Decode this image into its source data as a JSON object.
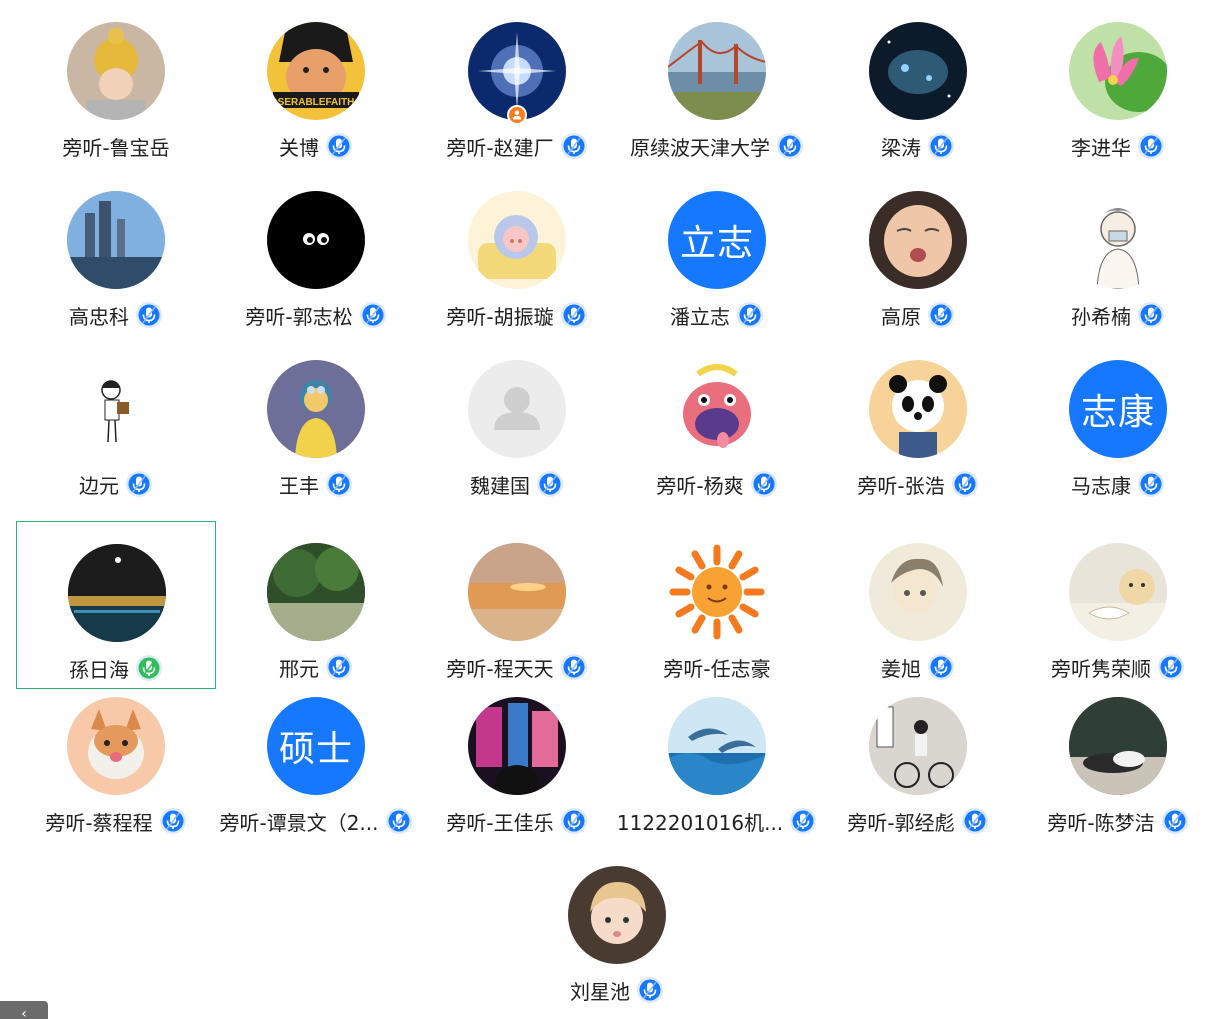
{
  "participants": [
    {
      "name": "旁听-鲁宝岳",
      "mic": "none",
      "avatar": "photo-child-yellow-hat"
    },
    {
      "name": "关博",
      "mic": "blue",
      "avatar": "photo-cartoon-face"
    },
    {
      "name": "旁听-赵建厂",
      "mic": "blue",
      "avatar": "photo-starburst",
      "host": true
    },
    {
      "name": "原续波天津大学",
      "mic": "blue",
      "avatar": "photo-golden-gate"
    },
    {
      "name": "梁涛",
      "mic": "blue",
      "avatar": "photo-space-ship"
    },
    {
      "name": "李进华",
      "mic": "blue",
      "avatar": "photo-lotus"
    },
    {
      "name": "高忠科",
      "mic": "blue",
      "avatar": "photo-skyline"
    },
    {
      "name": "旁听-郭志松",
      "mic": "blue",
      "avatar": "photo-black-eyes"
    },
    {
      "name": "旁听-胡振璇",
      "mic": "blue",
      "avatar": "photo-cartoon-pig-sleep"
    },
    {
      "name": "潘立志",
      "mic": "blue",
      "avatar_text": "立志"
    },
    {
      "name": "高原",
      "mic": "blue",
      "avatar": "photo-baby"
    },
    {
      "name": "孙希楠",
      "mic": "blue",
      "avatar": "photo-sketch-person"
    },
    {
      "name": "边元",
      "mic": "blue",
      "avatar": "photo-sketch-girl"
    },
    {
      "name": "王丰",
      "mic": "blue",
      "avatar": "photo-cartoon-yellow"
    },
    {
      "name": "魏建国",
      "mic": "blue",
      "avatar": "placeholder-person"
    },
    {
      "name": "旁听-杨爽",
      "mic": "blue",
      "avatar": "photo-cartoon-pig-banana"
    },
    {
      "name": "旁听-张浩",
      "mic": "blue",
      "avatar": "photo-panda"
    },
    {
      "name": "马志康",
      "mic": "blue",
      "avatar_text": "志康"
    },
    {
      "name": "孫日海",
      "mic": "green",
      "avatar": "photo-night-river",
      "active": true
    },
    {
      "name": "邢元",
      "mic": "blue",
      "avatar": "photo-trees"
    },
    {
      "name": "旁听-程天天",
      "mic": "blue",
      "avatar": "photo-sunset-beach"
    },
    {
      "name": "旁听-任志豪",
      "mic": "none",
      "avatar": "photo-sun-icon"
    },
    {
      "name": "姜旭",
      "mic": "blue",
      "avatar": "photo-anime-girl"
    },
    {
      "name": "旁听隽荣顺",
      "mic": "blue",
      "avatar": "photo-dog-book"
    },
    {
      "name": "旁听-蔡程程",
      "mic": "blue",
      "avatar": "photo-corgi"
    },
    {
      "name": "旁听-谭景文（2...",
      "mic": "blue",
      "avatar_text": "硕士"
    },
    {
      "name": "旁听-王佳乐",
      "mic": "blue",
      "avatar": "photo-city-night"
    },
    {
      "name": "1122201016机...",
      "mic": "blue",
      "avatar": "photo-dolphins"
    },
    {
      "name": "旁听-郭经彪",
      "mic": "blue",
      "avatar": "photo-bike"
    },
    {
      "name": "旁听-陈梦洁",
      "mic": "blue",
      "avatar": "photo-classroom"
    },
    {
      "name": "刘星池",
      "mic": "blue",
      "avatar": "photo-boy"
    }
  ],
  "colors": {
    "mic_blue": "#1677ff",
    "mic_green": "#2fbf5a",
    "active_border": "#2db37a",
    "text_avatar_bg": "#1677ff"
  },
  "corner_widget": {
    "icon": "chevron-left-icon"
  }
}
